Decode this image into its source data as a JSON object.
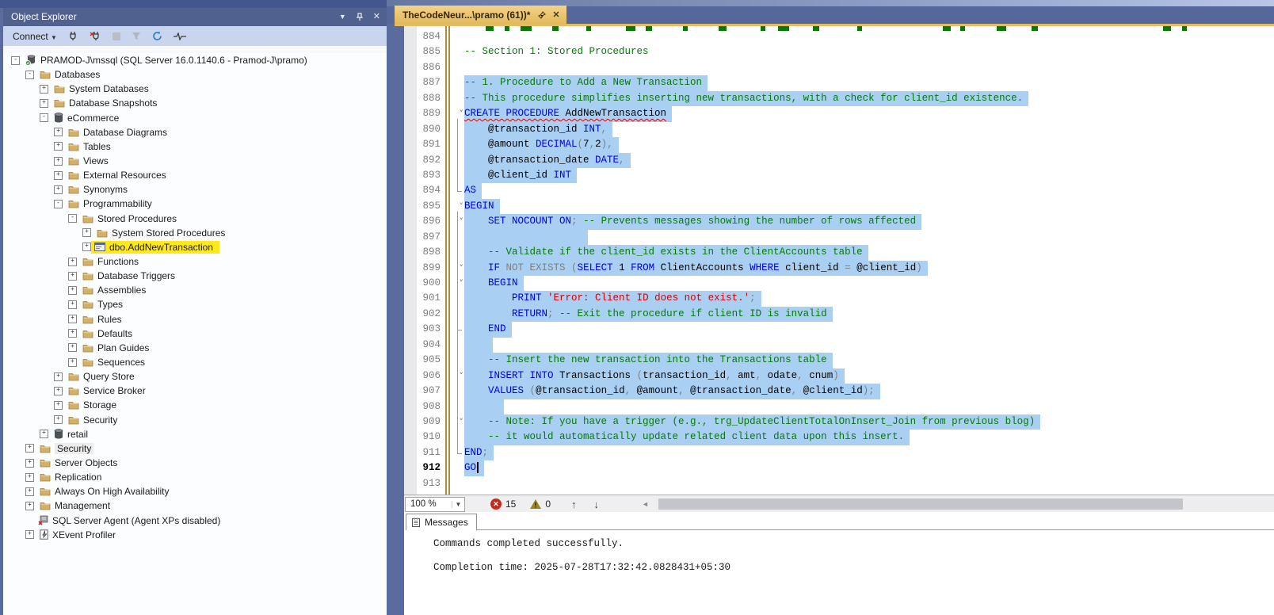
{
  "colors": {
    "selection": "#A9CFF2",
    "keyword": "#0000E8",
    "comment": "#067A06",
    "string": "#D80000",
    "operator_gray": "#808080",
    "tab_tan": "#E9C468",
    "highlight_yellow": "#FFE81C",
    "frame_blue": "#5A6B9D",
    "error_red": "#C42B1C"
  },
  "object_explorer": {
    "title": "Object Explorer",
    "connect_label": "Connect",
    "toolbar_icons": [
      "connect-plug-icon",
      "disconnect-plug-icon",
      "stop-icon",
      "filter-icon",
      "refresh-icon",
      "activity-monitor-icon"
    ],
    "title_icons": [
      "window-position-chevron-icon",
      "pin-icon",
      "close-icon"
    ],
    "tree": [
      {
        "label": "PRAMOD-J\\mssql (SQL Server 16.0.1140.6 - Pramod-J\\pramo)",
        "level": 0,
        "exp": "minus",
        "icon": "server"
      },
      {
        "label": "Databases",
        "level": 1,
        "exp": "minus",
        "icon": "folder"
      },
      {
        "label": "System Databases",
        "level": 2,
        "exp": "plus",
        "icon": "folder"
      },
      {
        "label": "Database Snapshots",
        "level": 2,
        "exp": "plus",
        "icon": "folder"
      },
      {
        "label": "eCommerce",
        "level": 2,
        "exp": "minus",
        "icon": "db"
      },
      {
        "label": "Database Diagrams",
        "level": 3,
        "exp": "plus",
        "icon": "folder"
      },
      {
        "label": "Tables",
        "level": 3,
        "exp": "plus",
        "icon": "folder"
      },
      {
        "label": "Views",
        "level": 3,
        "exp": "plus",
        "icon": "folder"
      },
      {
        "label": "External Resources",
        "level": 3,
        "exp": "plus",
        "icon": "folder"
      },
      {
        "label": "Synonyms",
        "level": 3,
        "exp": "plus",
        "icon": "folder"
      },
      {
        "label": "Programmability",
        "level": 3,
        "exp": "minus",
        "icon": "folder"
      },
      {
        "label": "Stored Procedures",
        "level": 4,
        "exp": "minus",
        "icon": "folder"
      },
      {
        "label": "System Stored Procedures",
        "level": 5,
        "exp": "plus",
        "icon": "folder"
      },
      {
        "label": "dbo.AddNewTransaction",
        "level": 5,
        "exp": "plus",
        "icon": "sproc",
        "hl": "yellow"
      },
      {
        "label": "Functions",
        "level": 4,
        "exp": "plus",
        "icon": "folder"
      },
      {
        "label": "Database Triggers",
        "level": 4,
        "exp": "plus",
        "icon": "folder"
      },
      {
        "label": "Assemblies",
        "level": 4,
        "exp": "plus",
        "icon": "folder"
      },
      {
        "label": "Types",
        "level": 4,
        "exp": "plus",
        "icon": "folder"
      },
      {
        "label": "Rules",
        "level": 4,
        "exp": "plus",
        "icon": "folder"
      },
      {
        "label": "Defaults",
        "level": 4,
        "exp": "plus",
        "icon": "folder"
      },
      {
        "label": "Plan Guides",
        "level": 4,
        "exp": "plus",
        "icon": "folder"
      },
      {
        "label": "Sequences",
        "level": 4,
        "exp": "plus",
        "icon": "folder"
      },
      {
        "label": "Query Store",
        "level": 3,
        "exp": "plus",
        "icon": "folder"
      },
      {
        "label": "Service Broker",
        "level": 3,
        "exp": "plus",
        "icon": "folder"
      },
      {
        "label": "Storage",
        "level": 3,
        "exp": "plus",
        "icon": "folder"
      },
      {
        "label": "Security",
        "level": 3,
        "exp": "plus",
        "icon": "folder"
      },
      {
        "label": "retail",
        "level": 2,
        "exp": "plus",
        "icon": "db"
      },
      {
        "label": "Security",
        "level": 1,
        "exp": "plus",
        "icon": "folder",
        "hl": "gray"
      },
      {
        "label": "Server Objects",
        "level": 1,
        "exp": "plus",
        "icon": "folder"
      },
      {
        "label": "Replication",
        "level": 1,
        "exp": "plus",
        "icon": "folder"
      },
      {
        "label": "Always On High Availability",
        "level": 1,
        "exp": "plus",
        "icon": "folder"
      },
      {
        "label": "Management",
        "level": 1,
        "exp": "plus",
        "icon": "folder"
      },
      {
        "label": "SQL Server Agent (Agent XPs disabled)",
        "level": 1,
        "exp": "none",
        "icon": "agent"
      },
      {
        "label": "XEvent Profiler",
        "level": 1,
        "exp": "plus",
        "icon": "xevent"
      }
    ]
  },
  "editor": {
    "tab_title": "TheCodeNeur...\\pramo (61))*",
    "status": {
      "zoom": "100 %",
      "errors": "15",
      "warnings": "0"
    },
    "lines": [
      {
        "n": "884",
        "sel": false,
        "tokens": []
      },
      {
        "n": "885",
        "sel": false,
        "tokens": [
          [
            "c",
            "-- Section 1: Stored Procedures"
          ]
        ]
      },
      {
        "n": "886",
        "sel": false,
        "tokens": []
      },
      {
        "n": "887",
        "sel": true,
        "tokens": [
          [
            "c",
            "-- 1. Procedure to Add a New Transaction"
          ]
        ]
      },
      {
        "n": "888",
        "sel": true,
        "tokens": [
          [
            "c",
            "-- This procedure simplifies inserting new transactions, with a check for client_id existence."
          ]
        ]
      },
      {
        "n": "889",
        "sel": true,
        "fold": true,
        "sq": true,
        "tokens": [
          [
            "k",
            "CREATE PROCEDURE"
          ],
          [
            "i",
            " AddNewTransaction"
          ]
        ]
      },
      {
        "n": "890",
        "sel": true,
        "tokens": [
          [
            "i",
            "    @transaction_id "
          ],
          [
            "k",
            "INT"
          ],
          [
            "g",
            ","
          ]
        ]
      },
      {
        "n": "891",
        "sel": true,
        "tokens": [
          [
            "i",
            "    @amount "
          ],
          [
            "k",
            "DECIMAL"
          ],
          [
            "g",
            "("
          ],
          [
            "i",
            "7"
          ],
          [
            "g",
            ","
          ],
          [
            "i",
            "2"
          ],
          [
            "g",
            "),"
          ]
        ]
      },
      {
        "n": "892",
        "sel": true,
        "tokens": [
          [
            "i",
            "    @transaction_date "
          ],
          [
            "k",
            "DATE"
          ],
          [
            "g",
            ","
          ]
        ]
      },
      {
        "n": "893",
        "sel": true,
        "tokens": [
          [
            "i",
            "    @client_id "
          ],
          [
            "k",
            "INT"
          ]
        ]
      },
      {
        "n": "894",
        "sel": true,
        "tokens": [
          [
            "k",
            "AS"
          ]
        ]
      },
      {
        "n": "895",
        "sel": true,
        "fold": true,
        "tokens": [
          [
            "k",
            "BEGIN"
          ]
        ]
      },
      {
        "n": "896",
        "sel": true,
        "fold": true,
        "tokens": [
          [
            "i",
            "    "
          ],
          [
            "k",
            "SET NOCOUNT ON"
          ],
          [
            "g",
            "; "
          ],
          [
            "c",
            "-- Prevents messages showing the number of rows affected"
          ]
        ]
      },
      {
        "n": "897",
        "sel": true,
        "selw": 156,
        "tokens": []
      },
      {
        "n": "898",
        "sel": true,
        "tokens": [
          [
            "i",
            "    "
          ],
          [
            "c",
            "-- Validate if the client_id exists in the ClientAccounts table"
          ]
        ]
      },
      {
        "n": "899",
        "sel": true,
        "fold": true,
        "tokens": [
          [
            "i",
            "    "
          ],
          [
            "k",
            "IF"
          ],
          [
            "g",
            " NOT EXISTS "
          ],
          [
            "g",
            "("
          ],
          [
            "k",
            "SELECT"
          ],
          [
            "i",
            " 1 "
          ],
          [
            "k",
            "FROM"
          ],
          [
            "i",
            " ClientAccounts "
          ],
          [
            "k",
            "WHERE"
          ],
          [
            "i",
            " client_id "
          ],
          [
            "g",
            "= "
          ],
          [
            "i",
            "@client_id"
          ],
          [
            "g",
            ")"
          ]
        ]
      },
      {
        "n": "900",
        "sel": true,
        "fold": true,
        "tokens": [
          [
            "i",
            "    "
          ],
          [
            "k",
            "BEGIN"
          ]
        ]
      },
      {
        "n": "901",
        "sel": true,
        "tokens": [
          [
            "i",
            "        "
          ],
          [
            "k",
            "PRINT"
          ],
          [
            "i",
            " "
          ],
          [
            "s",
            "'Error: Client ID does not exist.'"
          ],
          [
            "g",
            ";"
          ]
        ]
      },
      {
        "n": "902",
        "sel": true,
        "tokens": [
          [
            "i",
            "        "
          ],
          [
            "k",
            "RETURN"
          ],
          [
            "g",
            "; "
          ],
          [
            "c",
            "-- Exit the procedure if client ID is invalid"
          ]
        ]
      },
      {
        "n": "903",
        "sel": true,
        "tokens": [
          [
            "i",
            "    "
          ],
          [
            "k",
            "END"
          ]
        ]
      },
      {
        "n": "904",
        "sel": true,
        "selw": 36,
        "tokens": []
      },
      {
        "n": "905",
        "sel": true,
        "tokens": [
          [
            "i",
            "    "
          ],
          [
            "c",
            "-- Insert the new transaction into the Transactions table"
          ]
        ]
      },
      {
        "n": "906",
        "sel": true,
        "fold": true,
        "tokens": [
          [
            "i",
            "    "
          ],
          [
            "k",
            "INSERT INTO"
          ],
          [
            "i",
            " Transactions "
          ],
          [
            "g",
            "("
          ],
          [
            "i",
            "transaction_id"
          ],
          [
            "g",
            ", "
          ],
          [
            "i",
            "amt"
          ],
          [
            "g",
            ", "
          ],
          [
            "i",
            "odate"
          ],
          [
            "g",
            ", "
          ],
          [
            "i",
            "cnum"
          ],
          [
            "g",
            ")"
          ]
        ]
      },
      {
        "n": "907",
        "sel": true,
        "tokens": [
          [
            "i",
            "    "
          ],
          [
            "k",
            "VALUES"
          ],
          [
            "i",
            " "
          ],
          [
            "g",
            "("
          ],
          [
            "i",
            "@transaction_id"
          ],
          [
            "g",
            ", "
          ],
          [
            "i",
            "@amount"
          ],
          [
            "g",
            ", "
          ],
          [
            "i",
            "@transaction_date"
          ],
          [
            "g",
            ", "
          ],
          [
            "i",
            "@client_id"
          ],
          [
            "g",
            ");"
          ]
        ]
      },
      {
        "n": "908",
        "sel": true,
        "selw": 50,
        "tokens": []
      },
      {
        "n": "909",
        "sel": true,
        "fold": true,
        "tokens": [
          [
            "i",
            "    "
          ],
          [
            "c",
            "-- Note: If you have a trigger (e.g., trg_UpdateClientTotalOnInsert_Join from previous blog)"
          ]
        ]
      },
      {
        "n": "910",
        "sel": true,
        "tokens": [
          [
            "i",
            "    "
          ],
          [
            "c",
            "-- it would automatically update related client data upon this insert."
          ]
        ]
      },
      {
        "n": "911",
        "sel": true,
        "tokens": [
          [
            "k",
            "END"
          ],
          [
            "g",
            ";"
          ]
        ]
      },
      {
        "n": "912",
        "sel": true,
        "cur": true,
        "caret": true,
        "tokens": [
          [
            "k",
            "GO"
          ]
        ]
      },
      {
        "n": "913",
        "sel": false,
        "tokens": []
      }
    ]
  },
  "messages": {
    "tab_label": "Messages",
    "lines": [
      "Commands completed successfully.",
      "Completion time: 2025-07-28T17:32:42.0828431+05:30"
    ]
  }
}
